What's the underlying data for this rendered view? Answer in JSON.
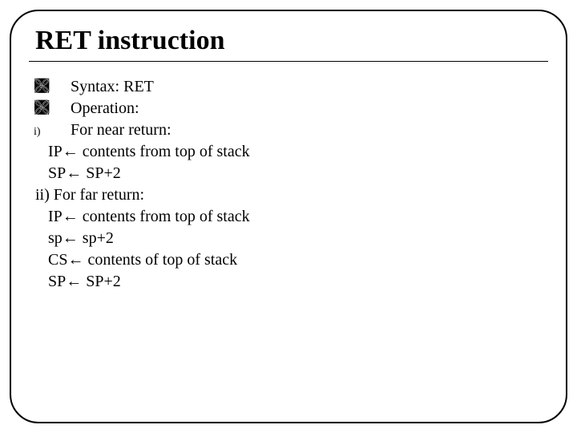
{
  "title": "RET instruction",
  "bullets": {
    "curly": "༼",
    "i": "i)"
  },
  "lines": {
    "syntax": "Syntax: RET",
    "operation": "Operation:",
    "near": "For near return:",
    "near_ip": "IP← contents from top of stack",
    "near_sp": "SP← SP+2",
    "far": "ii) For far return:",
    "far_ip": "IP← contents from top of stack",
    "far_sp1": "sp← sp+2",
    "far_cs": "CS← contents of top of stack",
    "far_sp2": "SP← SP+2"
  }
}
